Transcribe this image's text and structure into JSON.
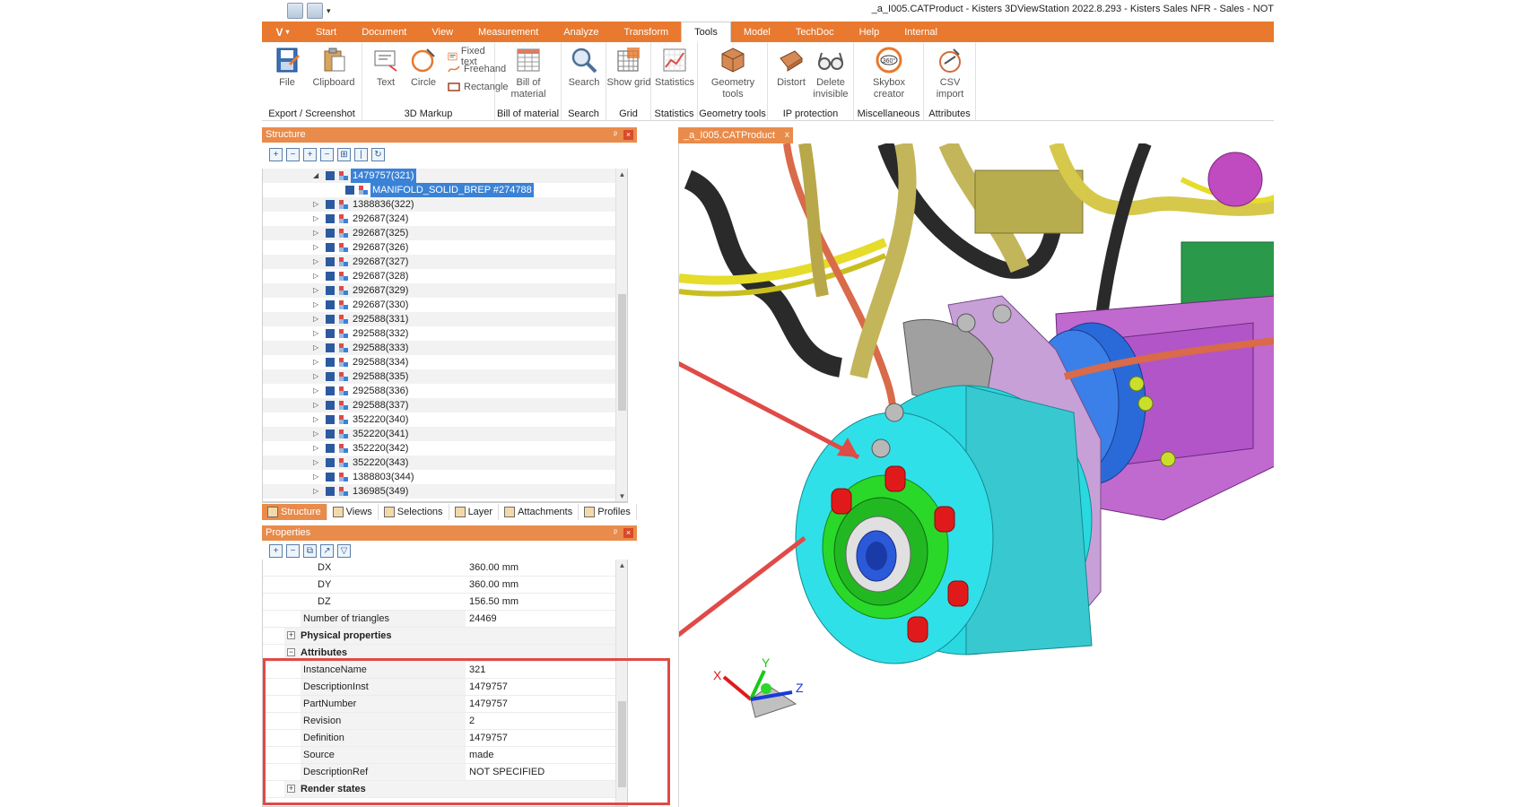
{
  "window": {
    "title": "_a_I005.CATProduct - Kisters 3DViewStation 2022.8.293 - Kisters Sales NFR - Sales - NOT"
  },
  "quick_access": {
    "dropdown": "▾"
  },
  "ribbon": {
    "app_button": "V",
    "tabs": [
      "Start",
      "Document",
      "View",
      "Measurement",
      "Analyze",
      "Transform",
      "Tools",
      "Model",
      "TechDoc",
      "Help",
      "Internal"
    ],
    "active_tab": "Tools",
    "groups": {
      "export": {
        "label": "Export / Screenshot",
        "file": "File",
        "clipboard": "Clipboard"
      },
      "markup": {
        "label": "3D Markup",
        "text": "Text",
        "circle": "Circle",
        "fixed_text": "Fixed text",
        "freehand": "Freehand",
        "rectangle": "Rectangle"
      },
      "bom": {
        "label": "Bill of material",
        "button": "Bill of material"
      },
      "search": {
        "label": "Search",
        "button": "Search"
      },
      "grid": {
        "label": "Grid",
        "button": "Show grid"
      },
      "statistics": {
        "label": "Statistics",
        "button": "Statistics"
      },
      "geometry": {
        "label": "Geometry tools",
        "button": "Geometry tools"
      },
      "ip": {
        "label": "IP protection",
        "distort": "Distort",
        "delete_invisible": "Delete invisible"
      },
      "misc": {
        "label": "Miscellaneous",
        "skybox": "Skybox creator"
      },
      "attributes": {
        "label": "Attributes",
        "csv": "CSV import"
      }
    }
  },
  "structure": {
    "title": "Structure",
    "rows": [
      {
        "label": "1479757(321)",
        "selected": true,
        "level": 0
      },
      {
        "label": "MANIFOLD_SOLID_BREP #274788",
        "selected": true,
        "level": 1
      },
      {
        "label": "1388836(322)",
        "selected": false,
        "level": 0
      },
      {
        "label": "292687(324)",
        "selected": false,
        "level": 0
      },
      {
        "label": "292687(325)",
        "selected": false,
        "level": 0
      },
      {
        "label": "292687(326)",
        "selected": false,
        "level": 0
      },
      {
        "label": "292687(327)",
        "selected": false,
        "level": 0
      },
      {
        "label": "292687(328)",
        "selected": false,
        "level": 0
      },
      {
        "label": "292687(329)",
        "selected": false,
        "level": 0
      },
      {
        "label": "292687(330)",
        "selected": false,
        "level": 0
      },
      {
        "label": "292588(331)",
        "selected": false,
        "level": 0
      },
      {
        "label": "292588(332)",
        "selected": false,
        "level": 0
      },
      {
        "label": "292588(333)",
        "selected": false,
        "level": 0
      },
      {
        "label": "292588(334)",
        "selected": false,
        "level": 0
      },
      {
        "label": "292588(335)",
        "selected": false,
        "level": 0
      },
      {
        "label": "292588(336)",
        "selected": false,
        "level": 0
      },
      {
        "label": "292588(337)",
        "selected": false,
        "level": 0
      },
      {
        "label": "352220(340)",
        "selected": false,
        "level": 0
      },
      {
        "label": "352220(341)",
        "selected": false,
        "level": 0
      },
      {
        "label": "352220(342)",
        "selected": false,
        "level": 0
      },
      {
        "label": "352220(343)",
        "selected": false,
        "level": 0
      },
      {
        "label": "1388803(344)",
        "selected": false,
        "level": 0
      },
      {
        "label": "136985(349)",
        "selected": false,
        "level": 0
      }
    ],
    "bottom_tabs": [
      "Structure",
      "Views",
      "Selections",
      "Layer",
      "Attachments",
      "Profiles"
    ]
  },
  "properties": {
    "title": "Properties",
    "rows": [
      {
        "key": "DX",
        "value": "360.00 mm",
        "kind": "indent"
      },
      {
        "key": "DY",
        "value": "360.00 mm",
        "kind": "indent"
      },
      {
        "key": "DZ",
        "value": "156.50 mm",
        "kind": "indent"
      },
      {
        "key": "Number of triangles",
        "value": "24469",
        "kind": "plain"
      },
      {
        "key": "Physical properties",
        "value": "",
        "kind": "section",
        "sign": "+"
      },
      {
        "key": "Attributes",
        "value": "",
        "kind": "section",
        "sign": "−"
      },
      {
        "key": "InstanceName",
        "value": "321",
        "kind": "plain"
      },
      {
        "key": "DescriptionInst",
        "value": "1479757",
        "kind": "plain"
      },
      {
        "key": "PartNumber",
        "value": "1479757",
        "kind": "plain"
      },
      {
        "key": "Revision",
        "value": "2",
        "kind": "plain"
      },
      {
        "key": "Definition",
        "value": "1479757",
        "kind": "plain"
      },
      {
        "key": "Source",
        "value": "made",
        "kind": "plain"
      },
      {
        "key": "DescriptionRef",
        "value": "NOT SPECIFIED",
        "kind": "plain"
      },
      {
        "key": "Render states",
        "value": "",
        "kind": "section",
        "sign": "+"
      }
    ]
  },
  "document": {
    "tab_label": "_a_I005.CATProduct",
    "close": "x"
  },
  "triad": {
    "x": "X",
    "y": "Y",
    "z": "Z"
  },
  "colors": {
    "accent": "#e8792e",
    "highlight": "#e04a47",
    "selection": "#3a82d6"
  }
}
